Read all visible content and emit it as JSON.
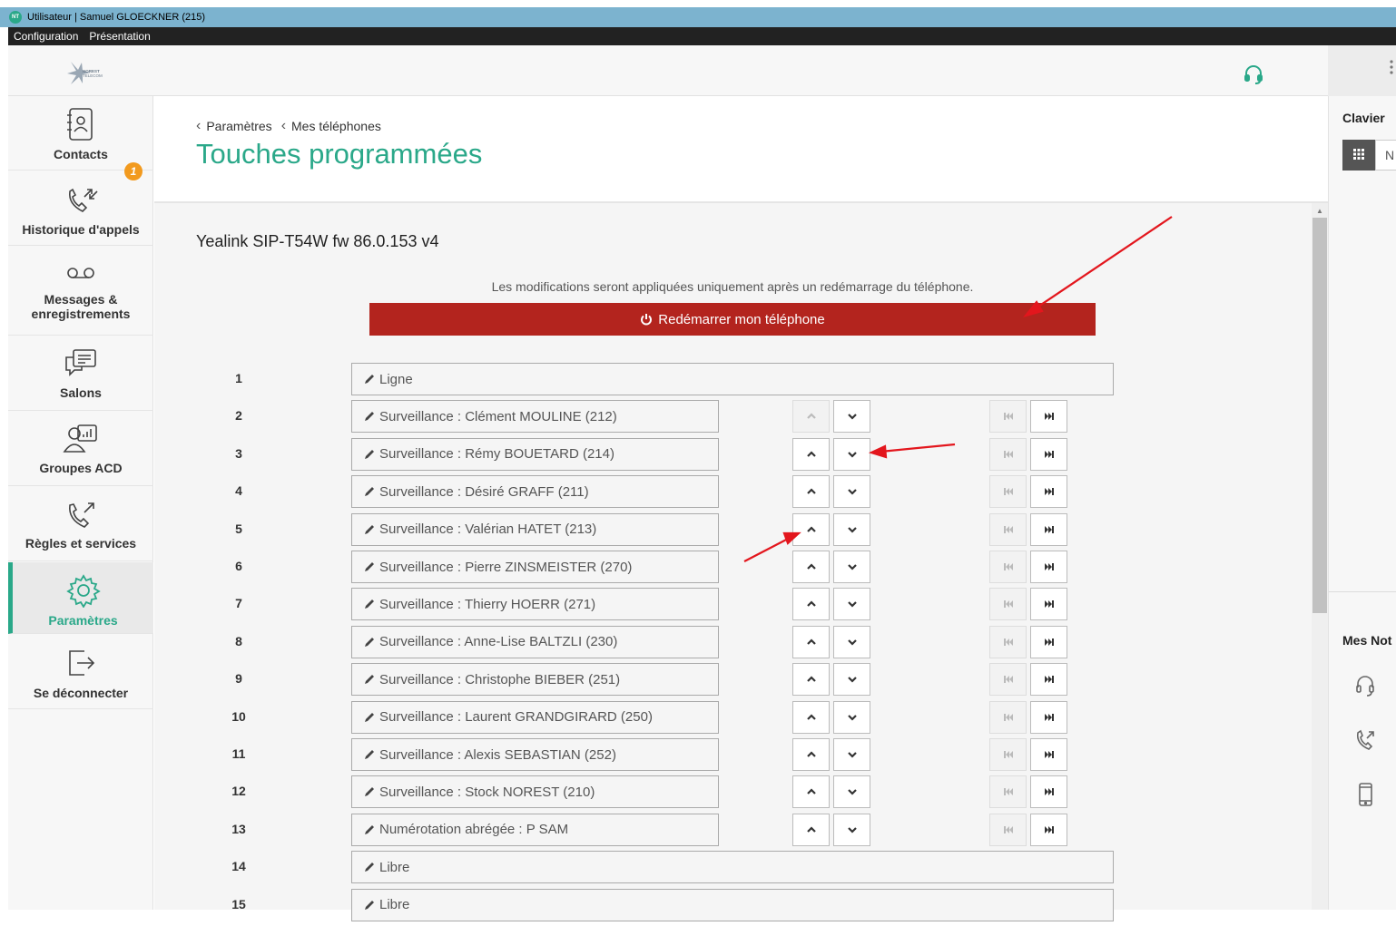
{
  "window": {
    "app_icon": "NT",
    "title": "Utilisateur | Samuel GLOECKNER (215)"
  },
  "menu": [
    "Configuration",
    "Présentation"
  ],
  "header": {
    "logo": "norest-telecom-logo",
    "logo_text": "NOREST TELECOM",
    "headset_icon": "headset-icon"
  },
  "sidebar": {
    "items": [
      {
        "label": "Contacts",
        "icon": "contacts-book-icon"
      },
      {
        "label": "Historique d'appels",
        "icon": "call-history-icon",
        "badge": "1"
      },
      {
        "label": "Messages & enregistrements",
        "icon": "voicemail-icon"
      },
      {
        "label": "Salons",
        "icon": "chat-rooms-icon"
      },
      {
        "label": "Groupes ACD",
        "icon": "acd-groups-icon"
      },
      {
        "label": "Règles et services",
        "icon": "call-rules-icon"
      },
      {
        "label": "Paramètres",
        "icon": "gear-icon",
        "active": true
      },
      {
        "label": "Se déconnecter",
        "icon": "logout-icon"
      }
    ]
  },
  "breadcrumb": [
    "Paramètres",
    "Mes téléphones"
  ],
  "page_title": "Touches programmées",
  "phone_model": "Yealink SIP-T54W fw 86.0.153 v4",
  "notice": "Les modifications seront appliquées uniquement après un redémarrage du téléphone.",
  "reboot_button": "Redémarrer mon téléphone",
  "keys": [
    {
      "num": "1",
      "label": "Ligne",
      "controls": false
    },
    {
      "num": "2",
      "label": "Surveillance : Clément MOULINE (212)",
      "controls": true,
      "up_disabled": true
    },
    {
      "num": "3",
      "label": "Surveillance : Rémy BOUETARD (214)",
      "controls": true
    },
    {
      "num": "4",
      "label": "Surveillance : Désiré GRAFF (211)",
      "controls": true
    },
    {
      "num": "5",
      "label": "Surveillance : Valérian HATET (213)",
      "controls": true
    },
    {
      "num": "6",
      "label": "Surveillance : Pierre ZINSMEISTER (270)",
      "controls": true
    },
    {
      "num": "7",
      "label": "Surveillance : Thierry HOERR (271)",
      "controls": true
    },
    {
      "num": "8",
      "label": "Surveillance : Anne-Lise BALTZLI (230)",
      "controls": true
    },
    {
      "num": "9",
      "label": "Surveillance : Christophe BIEBER (251)",
      "controls": true
    },
    {
      "num": "10",
      "label": "Surveillance : Laurent GRANDGIRARD (250)",
      "controls": true
    },
    {
      "num": "11",
      "label": "Surveillance : Alexis SEBASTIAN (252)",
      "controls": true
    },
    {
      "num": "12",
      "label": "Surveillance : Stock NOREST (210)",
      "controls": true
    },
    {
      "num": "13",
      "label": "Numérotation abrégée : P SAM",
      "controls": true
    },
    {
      "num": "14",
      "label": "Libre",
      "controls": false
    },
    {
      "num": "15",
      "label": "Libre",
      "controls": false
    }
  ],
  "right_panel": {
    "clavier_title": "Clavier",
    "input_placeholder": "N",
    "notes_title": "Mes Not",
    "icons": [
      "headset-icon",
      "phone-outgoing-icon",
      "mobile-phone-icon"
    ]
  },
  "colors": {
    "accent": "#2aa889",
    "danger": "#b3241e",
    "badge": "#f29a1e",
    "annotation": "#e3161d"
  }
}
